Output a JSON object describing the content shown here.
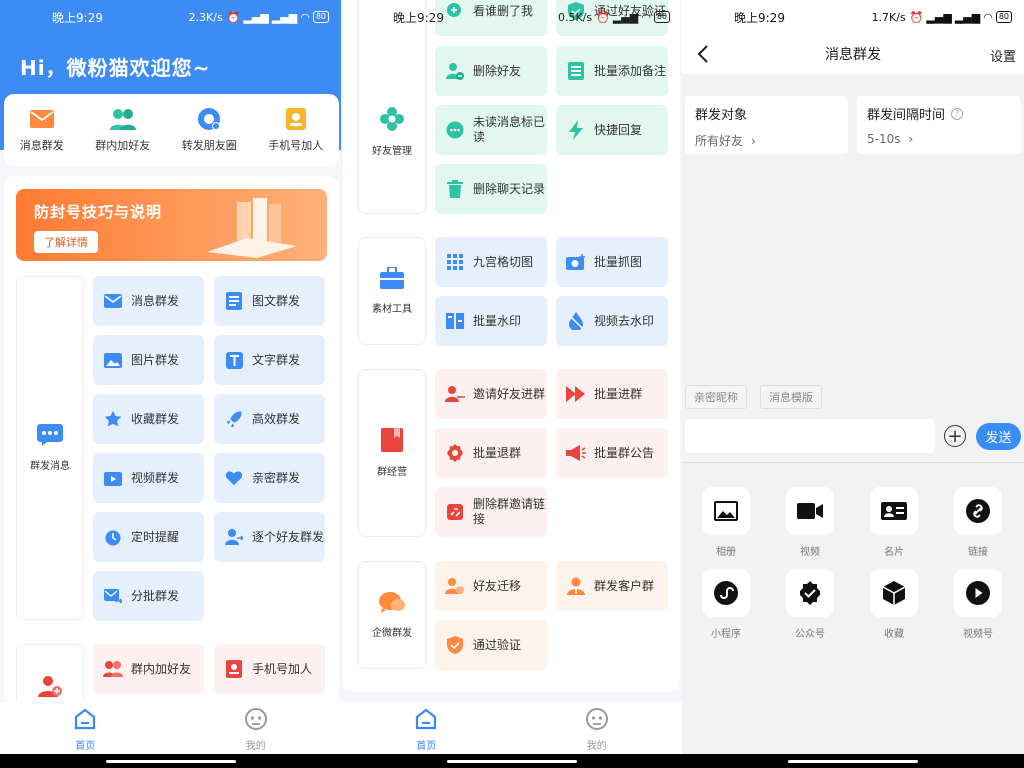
{
  "status": {
    "p1": {
      "time": "晚上9:29",
      "speed": "2.3K/s",
      "battery": "80"
    },
    "p2": {
      "time": "晚上9:29",
      "speed": "0.5K/s",
      "battery": "80"
    },
    "p3": {
      "time": "晚上9:29",
      "speed": "1.7K/s",
      "battery": "80"
    }
  },
  "home": {
    "greeting": "Hi，微粉猫欢迎您~",
    "quick": [
      "消息群发",
      "群内加好友",
      "转发朋友圈",
      "手机号加人"
    ],
    "banner": {
      "title": "防封号技巧与说明",
      "button": "了解详情"
    },
    "group_message": {
      "label": "群发消息",
      "items": [
        "消息群发",
        "图文群发",
        "图片群发",
        "文字群发",
        "收藏群发",
        "高效群发",
        "视频群发",
        "亲密群发",
        "定时提醒",
        "逐个好友群发",
        "分批群发"
      ]
    },
    "add_friend": {
      "items": [
        "群内加好友",
        "手机号加人"
      ]
    },
    "nav": {
      "home": "首页",
      "mine": "我的"
    }
  },
  "tools": {
    "friend_mgmt": {
      "label": "好友管理",
      "items": [
        "看谁删了我",
        "通过好友验证",
        "删除好友",
        "批量添加备注",
        "未读消息标已读",
        "快捷回复",
        "删除聊天记录"
      ]
    },
    "material": {
      "label": "素材工具",
      "items": [
        "九宫格切图",
        "批量抓图",
        "批量水印",
        "视频去水印"
      ]
    },
    "group_ops": {
      "label": "群经营",
      "items": [
        "邀请好友进群",
        "批量进群",
        "批量退群",
        "批量群公告",
        "删除群邀请链接"
      ]
    },
    "wecom": {
      "label": "企微群发",
      "items": [
        "好友迁移",
        "群发客户群",
        "通过验证"
      ]
    },
    "nav": {
      "home": "首页",
      "mine": "我的"
    }
  },
  "compose": {
    "title": "消息群发",
    "settings": "设置",
    "target": {
      "label": "群发对象",
      "value": "所有好友"
    },
    "interval": {
      "label": "群发间隔时间",
      "value": "5-10s"
    },
    "tags": [
      "亲密昵称",
      "消息模版"
    ],
    "send": "发送",
    "attachments": [
      "相册",
      "视频",
      "名片",
      "链接",
      "小程序",
      "公众号",
      "收藏",
      "视频号"
    ]
  },
  "colors": {
    "primary": "#3d8cf6",
    "orange": "#ff7a32"
  }
}
